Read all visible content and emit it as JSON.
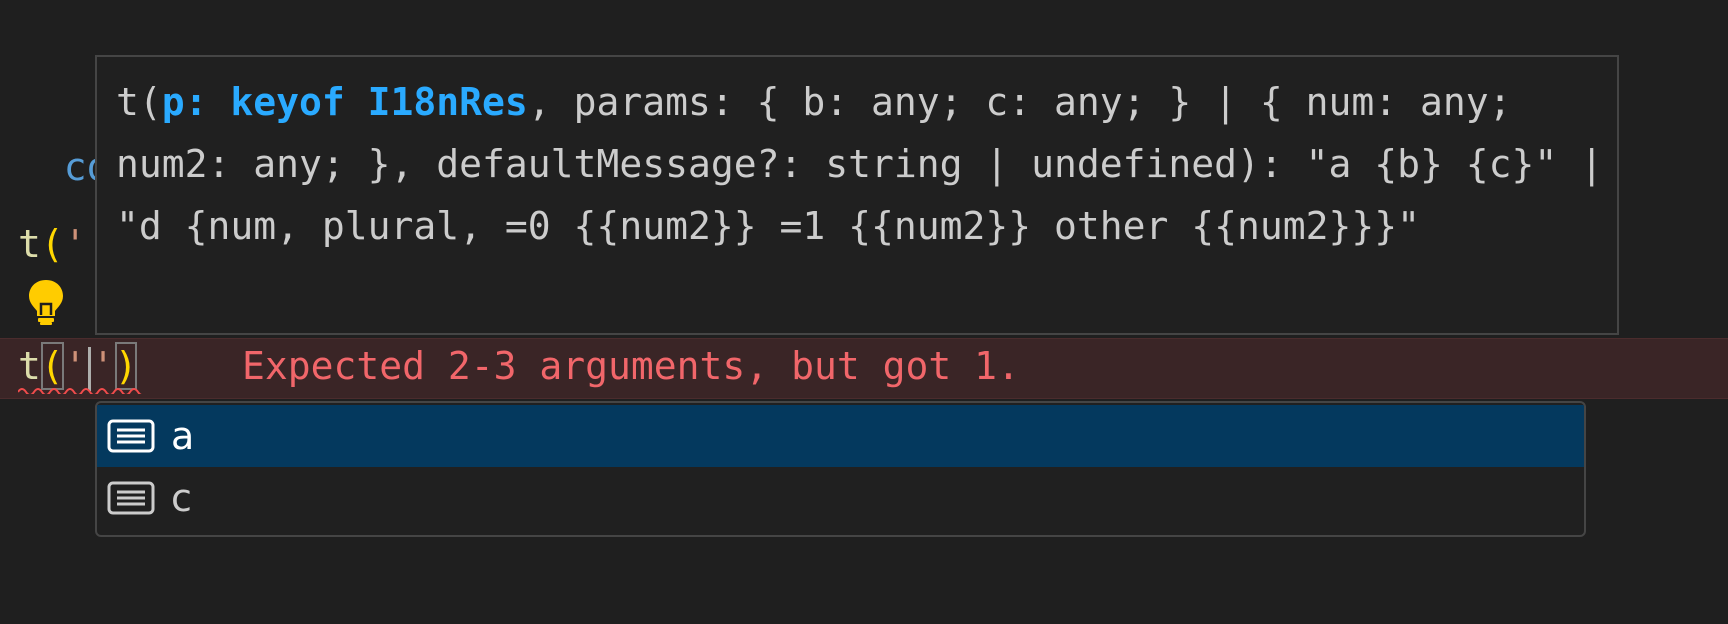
{
  "editor": {
    "line1_visible": "con",
    "line2_fn": "t",
    "line2_paren": "(",
    "line2_str": "'",
    "current_line": {
      "fn": "t",
      "open_paren": "(",
      "quote_open": "'",
      "quote_close": "'",
      "close_paren": ")"
    },
    "error_message": "Expected 2-3 arguments, but got 1."
  },
  "signature_help": {
    "prefix": "t(",
    "active_param": "p: keyof I18nRes",
    "rest": ", params: { b: any; c: any; } | { num: any; num2: any; }, defaultMessage?: string | undefined): \"a {b} {c}\" | \"d {num, plural, =0 {{num2}} =1 {{num2}} other {{num2}}}\""
  },
  "suggestions": [
    {
      "label": "a",
      "icon": "text-icon",
      "selected": true
    },
    {
      "label": "c",
      "icon": "text-icon",
      "selected": false
    }
  ],
  "colors": {
    "background": "#1f1f1f",
    "error_text": "#f1666a",
    "active_param": "#2aaaff",
    "selection": "#04395e",
    "lightbulb": "#ffcc00"
  }
}
